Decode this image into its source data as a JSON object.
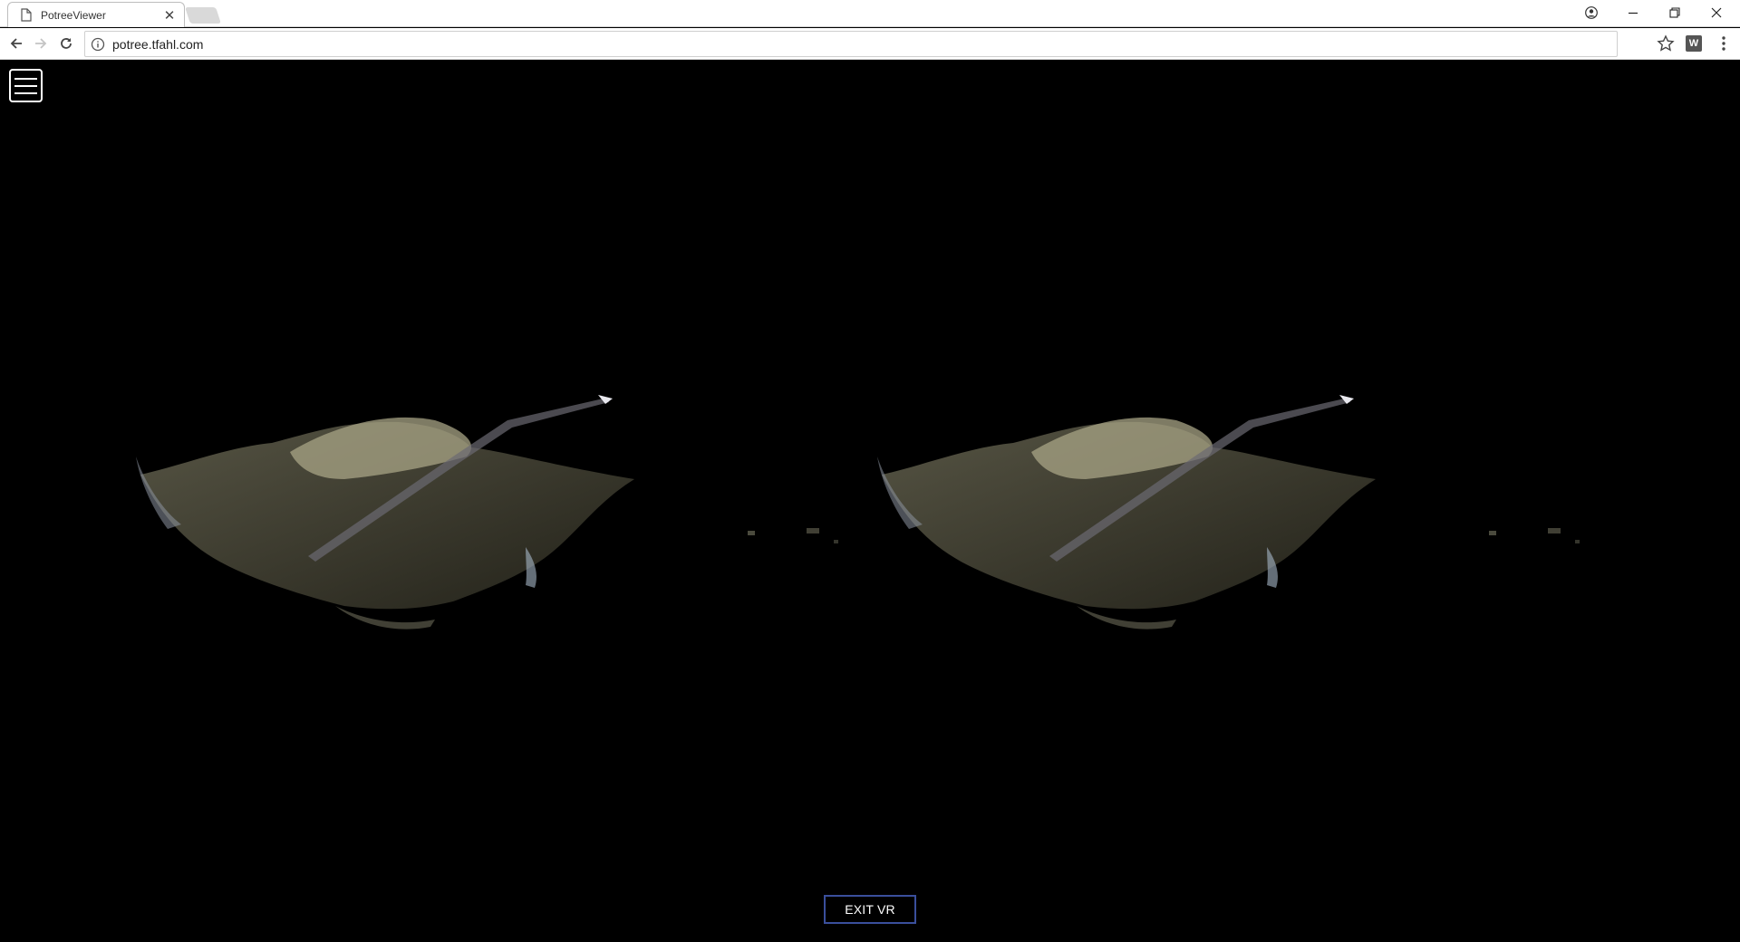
{
  "browser": {
    "tab_title": "PotreeViewer",
    "url": "potree.tfahl.com",
    "extension_label": "W",
    "icons": [
      "document-icon",
      "close-tab-icon",
      "new-tab-icon",
      "profile-icon",
      "minimize-icon",
      "restore-icon",
      "close-window-icon",
      "back-icon",
      "forward-icon",
      "reload-icon",
      "info-icon",
      "bookmark-star-icon",
      "menu-dots-icon"
    ]
  },
  "viewer": {
    "menu_icon": "hamburger-icon",
    "exit_vr_label": "EXIT VR",
    "background_color": "#000000",
    "accent_color": "#3a4f9c",
    "pointcloud_color": "#7d7a5e"
  }
}
